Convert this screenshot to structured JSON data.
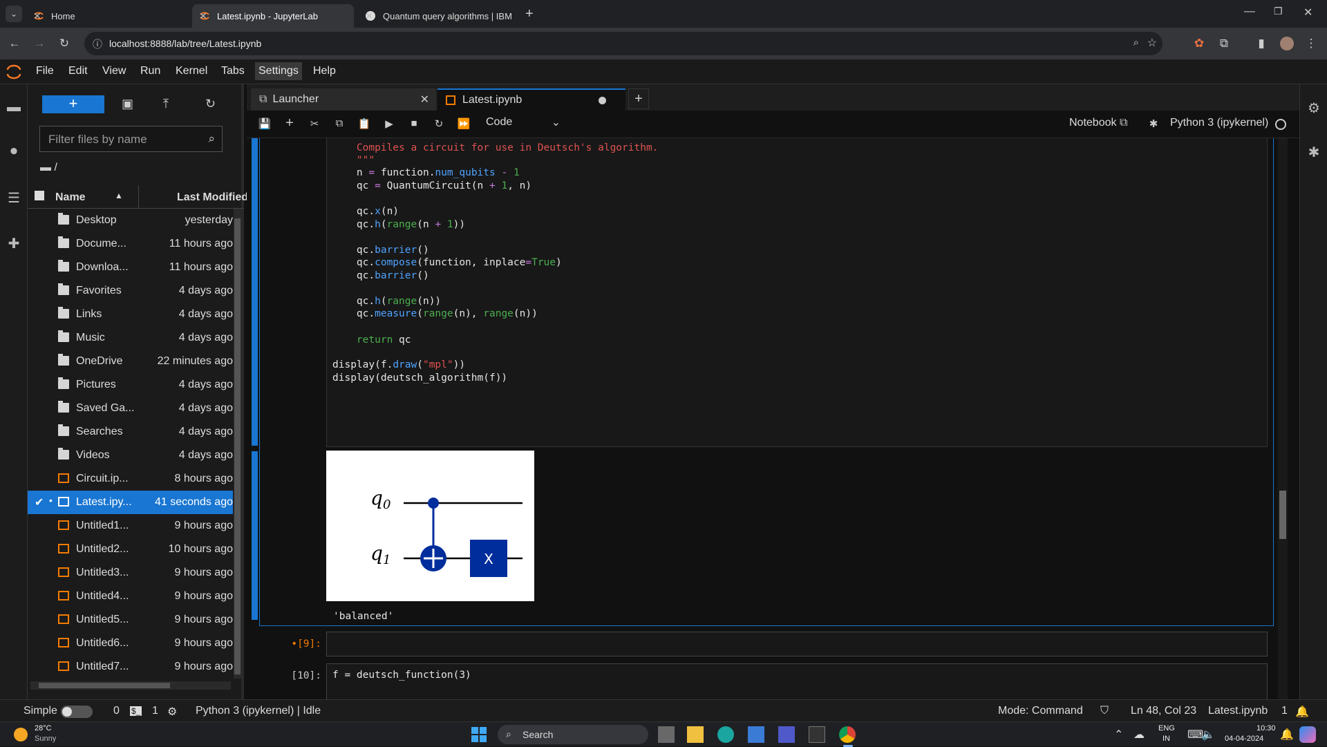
{
  "browser": {
    "tabs": [
      {
        "title": "Home",
        "active": false
      },
      {
        "title": "Latest.ipynb - JupyterLab",
        "active": true
      },
      {
        "title": "Quantum query algorithms | IBM",
        "active": false
      }
    ],
    "url": "localhost:8888/lab/tree/Latest.ipynb"
  },
  "menu": [
    "File",
    "Edit",
    "View",
    "Run",
    "Kernel",
    "Tabs",
    "Settings",
    "Help"
  ],
  "filebrowser": {
    "filter_placeholder": "Filter files by name",
    "breadcrumb": "/",
    "col_name": "Name",
    "col_modified": "Last Modified",
    "files": [
      {
        "name": "Desktop",
        "modified": "yesterday",
        "type": "folder"
      },
      {
        "name": "Docume...",
        "modified": "11 hours ago",
        "type": "folder"
      },
      {
        "name": "Downloa...",
        "modified": "11 hours ago",
        "type": "folder"
      },
      {
        "name": "Favorites",
        "modified": "4 days ago",
        "type": "folder"
      },
      {
        "name": "Links",
        "modified": "4 days ago",
        "type": "folder"
      },
      {
        "name": "Music",
        "modified": "4 days ago",
        "type": "folder"
      },
      {
        "name": "OneDrive",
        "modified": "22 minutes ago",
        "type": "folder"
      },
      {
        "name": "Pictures",
        "modified": "4 days ago",
        "type": "folder"
      },
      {
        "name": "Saved Ga...",
        "modified": "4 days ago",
        "type": "folder"
      },
      {
        "name": "Searches",
        "modified": "4 days ago",
        "type": "folder"
      },
      {
        "name": "Videos",
        "modified": "4 days ago",
        "type": "folder"
      },
      {
        "name": "Circuit.ip...",
        "modified": "8 hours ago",
        "type": "notebook"
      },
      {
        "name": "Latest.ipy...",
        "modified": "41 seconds ago",
        "type": "notebook",
        "selected": true
      },
      {
        "name": "Untitled1...",
        "modified": "9 hours ago",
        "type": "notebook"
      },
      {
        "name": "Untitled2...",
        "modified": "10 hours ago",
        "type": "notebook"
      },
      {
        "name": "Untitled3...",
        "modified": "9 hours ago",
        "type": "notebook"
      },
      {
        "name": "Untitled4...",
        "modified": "9 hours ago",
        "type": "notebook"
      },
      {
        "name": "Untitled5...",
        "modified": "9 hours ago",
        "type": "notebook"
      },
      {
        "name": "Untitled6...",
        "modified": "9 hours ago",
        "type": "notebook"
      },
      {
        "name": "Untitled7...",
        "modified": "9 hours ago",
        "type": "notebook"
      }
    ]
  },
  "doctabs": {
    "launcher": "Launcher",
    "notebook": "Latest.ipynb"
  },
  "toolbar": {
    "cell_type": "Code",
    "notebook_label": "Notebook",
    "kernel": "Python 3 (ipykernel)"
  },
  "cells": {
    "output_text": "'balanced'",
    "prompt_9": "•[9]:",
    "prompt_10": "[10]:",
    "cell10_line": "f = deutsch_function(3)"
  },
  "circuit": {
    "q0": "q",
    "q0_sub": "0",
    "q1": "q",
    "q1_sub": "1",
    "gate": "X"
  },
  "statusbar": {
    "mode_label": "Simple",
    "term_count": "0",
    "kernel_count": "1",
    "kernel_status": "Python 3 (ipykernel) | Idle",
    "mode": "Mode: Command",
    "position": "Ln 48, Col 23",
    "file": "Latest.ipynb",
    "notif": "1"
  },
  "taskbar": {
    "temp": "28°C",
    "weather": "Sunny",
    "search": "Search",
    "lang1": "ENG",
    "lang2": "IN",
    "time": "10:30",
    "date": "04-04-2024"
  }
}
